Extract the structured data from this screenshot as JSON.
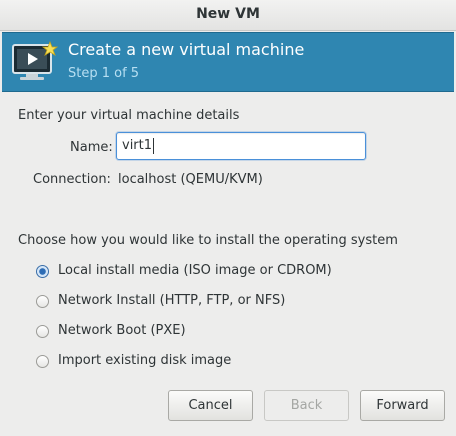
{
  "window": {
    "title": "New VM"
  },
  "banner": {
    "title": "Create a new virtual machine",
    "step": "Step 1 of 5",
    "icon": "monitor-wizard-icon"
  },
  "details": {
    "heading": "Enter your virtual machine details",
    "name_label": "Name:",
    "name_value": "virt1",
    "connection_label": "Connection:",
    "connection_value": "localhost (QEMU/KVM)"
  },
  "install": {
    "heading": "Choose how you would like to install the operating system",
    "options": [
      {
        "label": "Local install media (ISO image or CDROM)",
        "selected": true
      },
      {
        "label": "Network Install (HTTP, FTP, or NFS)",
        "selected": false
      },
      {
        "label": "Network Boot (PXE)",
        "selected": false
      },
      {
        "label": "Import existing disk image",
        "selected": false
      }
    ]
  },
  "buttons": {
    "cancel": "Cancel",
    "back": "Back",
    "forward": "Forward"
  },
  "colors": {
    "banner": "#2f86b1",
    "banner_step": "#b7dff2",
    "focus_border": "#4a90d9"
  }
}
